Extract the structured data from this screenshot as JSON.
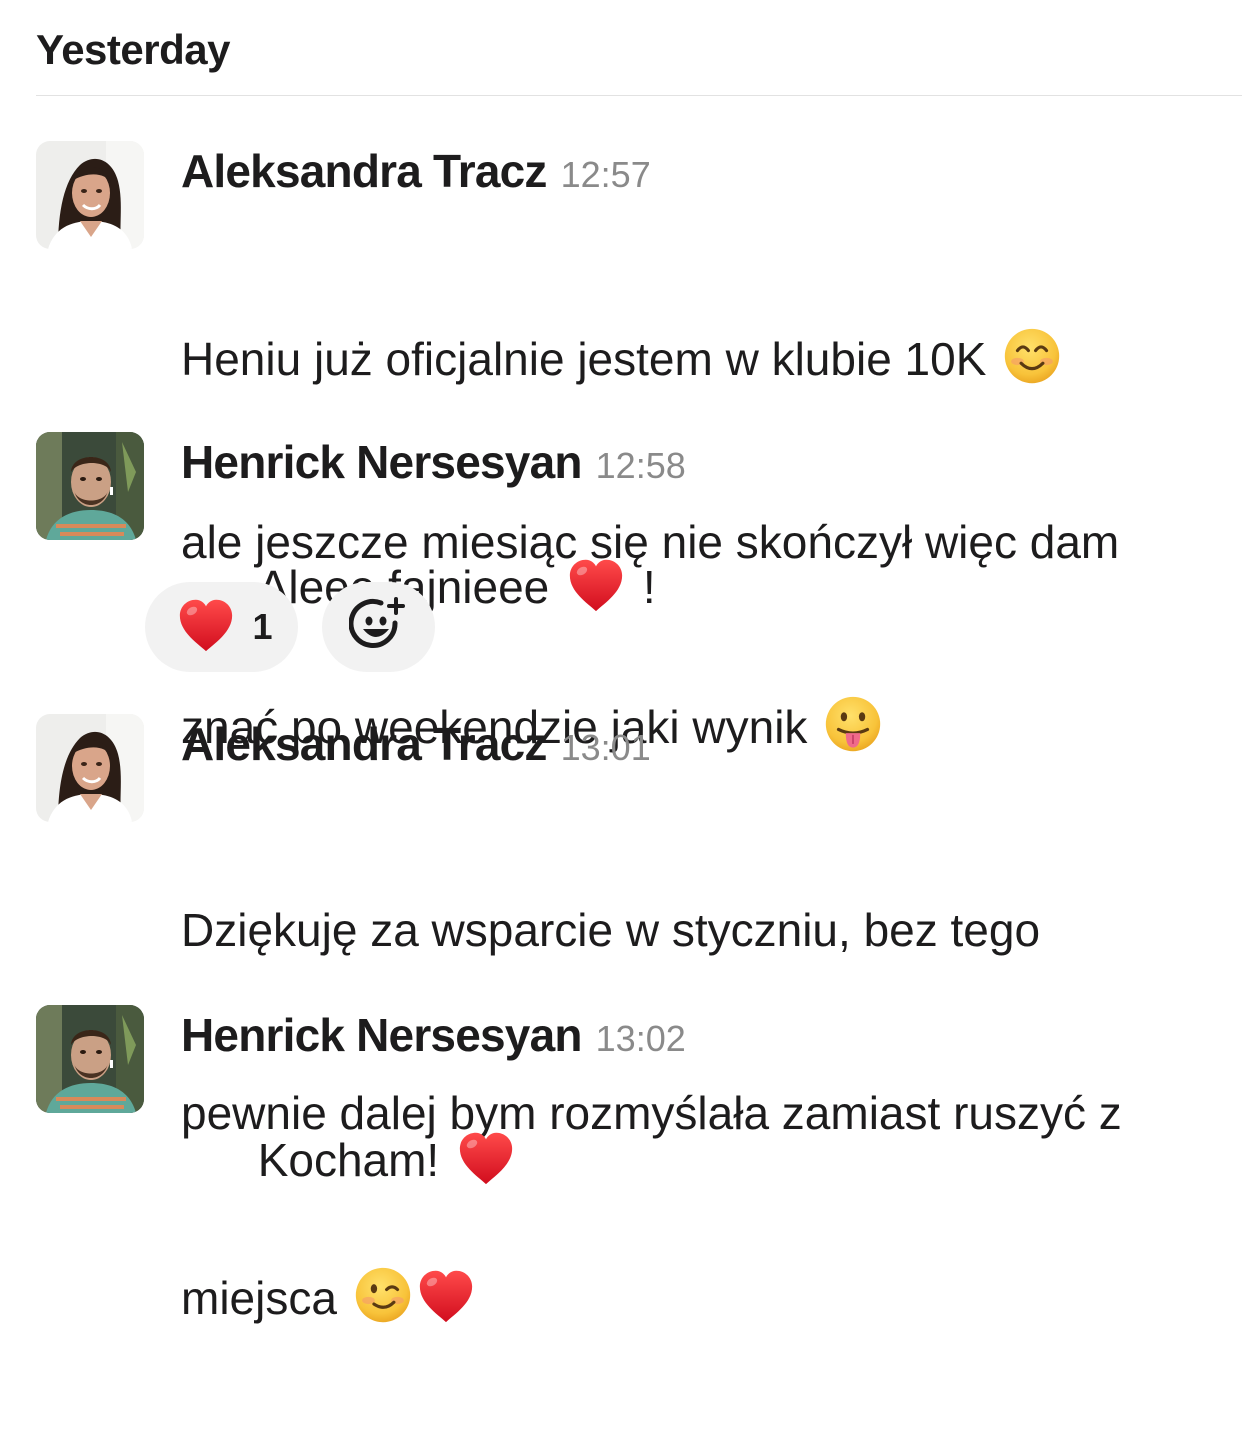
{
  "day_header": "Yesterday",
  "messages": [
    {
      "sender": "Aleksandra Tracz",
      "time": "12:57",
      "lines": [
        "Heniu już oficjalnie jestem w klubie 10K",
        "ale jeszcze miesiąc się nie skończył więc dam",
        "znać po weekendzie jaki wynik"
      ],
      "emojis": [
        "smiling-face-emoji",
        "tongue-face-emoji"
      ]
    },
    {
      "sender": "Henrick Nersesyan",
      "time": "12:58",
      "text": "Aleee fajnieee",
      "text_after_emoji": "!",
      "emojis": [
        "red-heart-emoji"
      ],
      "reactions": [
        {
          "emoji": "red-heart-emoji",
          "count": "1"
        }
      ],
      "add_reaction_icon": "add-reaction-icon"
    },
    {
      "sender": "Aleksandra Tracz",
      "time": "13:01",
      "lines": [
        "Dziękuję za wsparcie w styczniu, bez tego",
        "pewnie dalej bym rozmyślała zamiast ruszyć z",
        "miejsca"
      ],
      "emojis": [
        "winking-face-emoji",
        "red-heart-emoji"
      ]
    },
    {
      "sender": "Henrick Nersesyan",
      "time": "13:02",
      "text": "Kocham!",
      "emojis": [
        "red-heart-emoji"
      ]
    }
  ],
  "colors": {
    "text": "#1d1c1d",
    "timestamp": "#8a8a8a",
    "divider": "#e2e2e2",
    "reaction_bg": "#f2f2f2",
    "heart": "#e8202f",
    "emoji_face": "#f7c23a"
  }
}
